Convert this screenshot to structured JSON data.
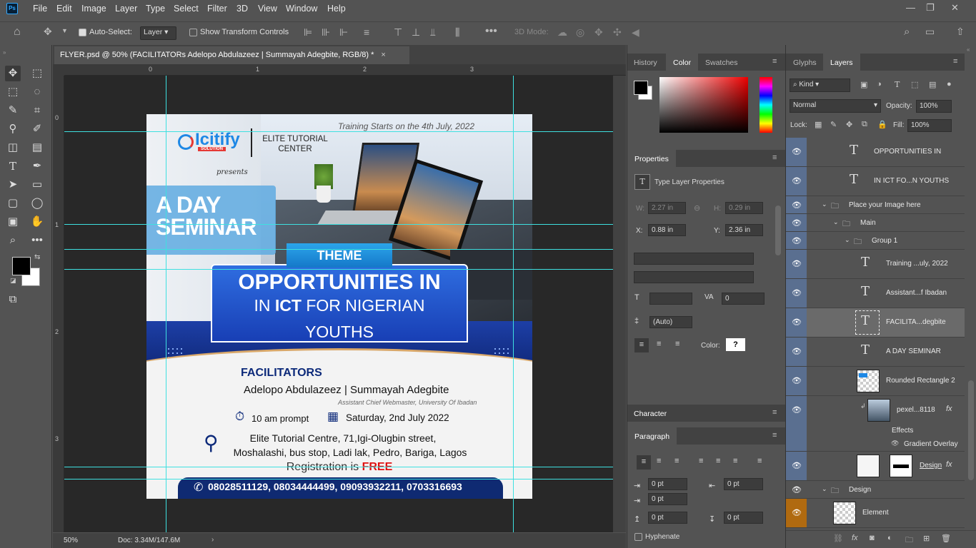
{
  "menubar": {
    "items": [
      "File",
      "Edit",
      "Image",
      "Layer",
      "Type",
      "Select",
      "Filter",
      "3D",
      "View",
      "Window",
      "Help"
    ],
    "logo": "Ps"
  },
  "options": {
    "auto_select_label": "Auto-Select:",
    "auto_select_value": "Layer",
    "transform_label": "Show Transform Controls",
    "mode3d": "3D Mode:"
  },
  "document": {
    "tab_title": "FLYER.psd @ 50% (FACILITATORs  Adelopo Abdulazeez  | Summayah Adegbite, RGB/8) *",
    "zoom": "50%",
    "doc_size": "Doc: 3.34M/147.6M",
    "ruler_h": [
      "0",
      "1",
      "2",
      "3"
    ],
    "ruler_v": [
      "0",
      "1",
      "2",
      "3"
    ]
  },
  "flyer": {
    "training": "Training Starts on the 4th July, 2022",
    "logo_name": "Icitify",
    "logo_sub": "SOLUTION",
    "center": "ELITE TUTORIAL CENTER",
    "presents": "presents",
    "day_seminar_1": "A DAY",
    "day_seminar_2": "SEMINAR",
    "theme": "THEME",
    "headline1": "OPPORTUNITIES IN",
    "headline2_pre": "IN ",
    "headline2_bold": "ICT",
    "headline2_post": " FOR NIGERIAN",
    "headline3": "YOUTHS",
    "facilitators": "FACILITATORS",
    "names": "Adelopo Abdulazeez  | Summayah Adegbite",
    "role": "Assistant Chief Webmaster, University Of Ibadan",
    "time": "10 am prompt",
    "date": "Saturday, 2nd July 2022",
    "venue1": "Elite Tutorial Centre, 71,Igi-Olugbin street,",
    "venue2": "Moshalashi, bus stop, Ladi lak, Pedro, Bariga, Lagos",
    "reg": "Registration is ",
    "free": "FREE",
    "phones": "08028511129, 08034444499, 09093932211,  0703316693"
  },
  "color_panel": {
    "tabs": [
      "History",
      "Color",
      "Swatches"
    ],
    "active": "Color"
  },
  "properties": {
    "title": "Properties",
    "type_label": "Type Layer Properties",
    "w": "W:",
    "w_val": "2.27 in",
    "h": "H:",
    "h_val": "0.29 in",
    "x": "X:",
    "x_val": "0.88 in",
    "y": "Y:",
    "y_val": "2.36 in",
    "tracking": "0",
    "leading": "(Auto)",
    "color_label": "Color:"
  },
  "character": {
    "title": "Character"
  },
  "paragraph": {
    "title": "Paragraph",
    "values": [
      "0 pt",
      "0 pt",
      "0 pt",
      "0 pt",
      "0 pt"
    ],
    "hyphenate": "Hyphenate"
  },
  "layers_panel": {
    "tabs": [
      "Glyphs",
      "Layers"
    ],
    "active": "Layers",
    "filter": "Kind",
    "blend": "Normal",
    "opacity_label": "Opacity:",
    "opacity": "100%",
    "lock_label": "Lock:",
    "fill_label": "Fill:",
    "fill": "100%",
    "rows": [
      {
        "name": "OPPORTUNITIES IN",
        "kind": "text",
        "indent": 0
      },
      {
        "name": "IN ICT FO...N  YOUTHS",
        "kind": "text",
        "indent": 0
      },
      {
        "name": "Place your Image here",
        "kind": "group",
        "indent": 0
      },
      {
        "name": "Main",
        "kind": "group",
        "indent": 1
      },
      {
        "name": "Group 1",
        "kind": "group",
        "indent": 2
      },
      {
        "name": "Training ...uly, 2022",
        "kind": "text",
        "indent": 3
      },
      {
        "name": "Assistant...f Ibadan",
        "kind": "text",
        "indent": 3
      },
      {
        "name": "FACILITA...degbite",
        "kind": "text",
        "indent": 3,
        "selected": true
      },
      {
        "name": "A DAY SEMINAR",
        "kind": "text",
        "indent": 3
      },
      {
        "name": "Rounded Rectangle 2",
        "kind": "shape",
        "indent": 3
      },
      {
        "name": "pexel...8118",
        "kind": "image",
        "indent": 3,
        "fx": "fx"
      },
      {
        "name": "Effects",
        "kind": "effects",
        "indent": 4
      },
      {
        "name": "Gradient Overlay",
        "kind": "effect",
        "indent": 4
      },
      {
        "name": "Design",
        "kind": "mask",
        "indent": 3,
        "fx": "fx"
      },
      {
        "name": "Design",
        "kind": "group",
        "indent": 0
      },
      {
        "name": "Element",
        "kind": "image",
        "indent": 1
      }
    ]
  }
}
